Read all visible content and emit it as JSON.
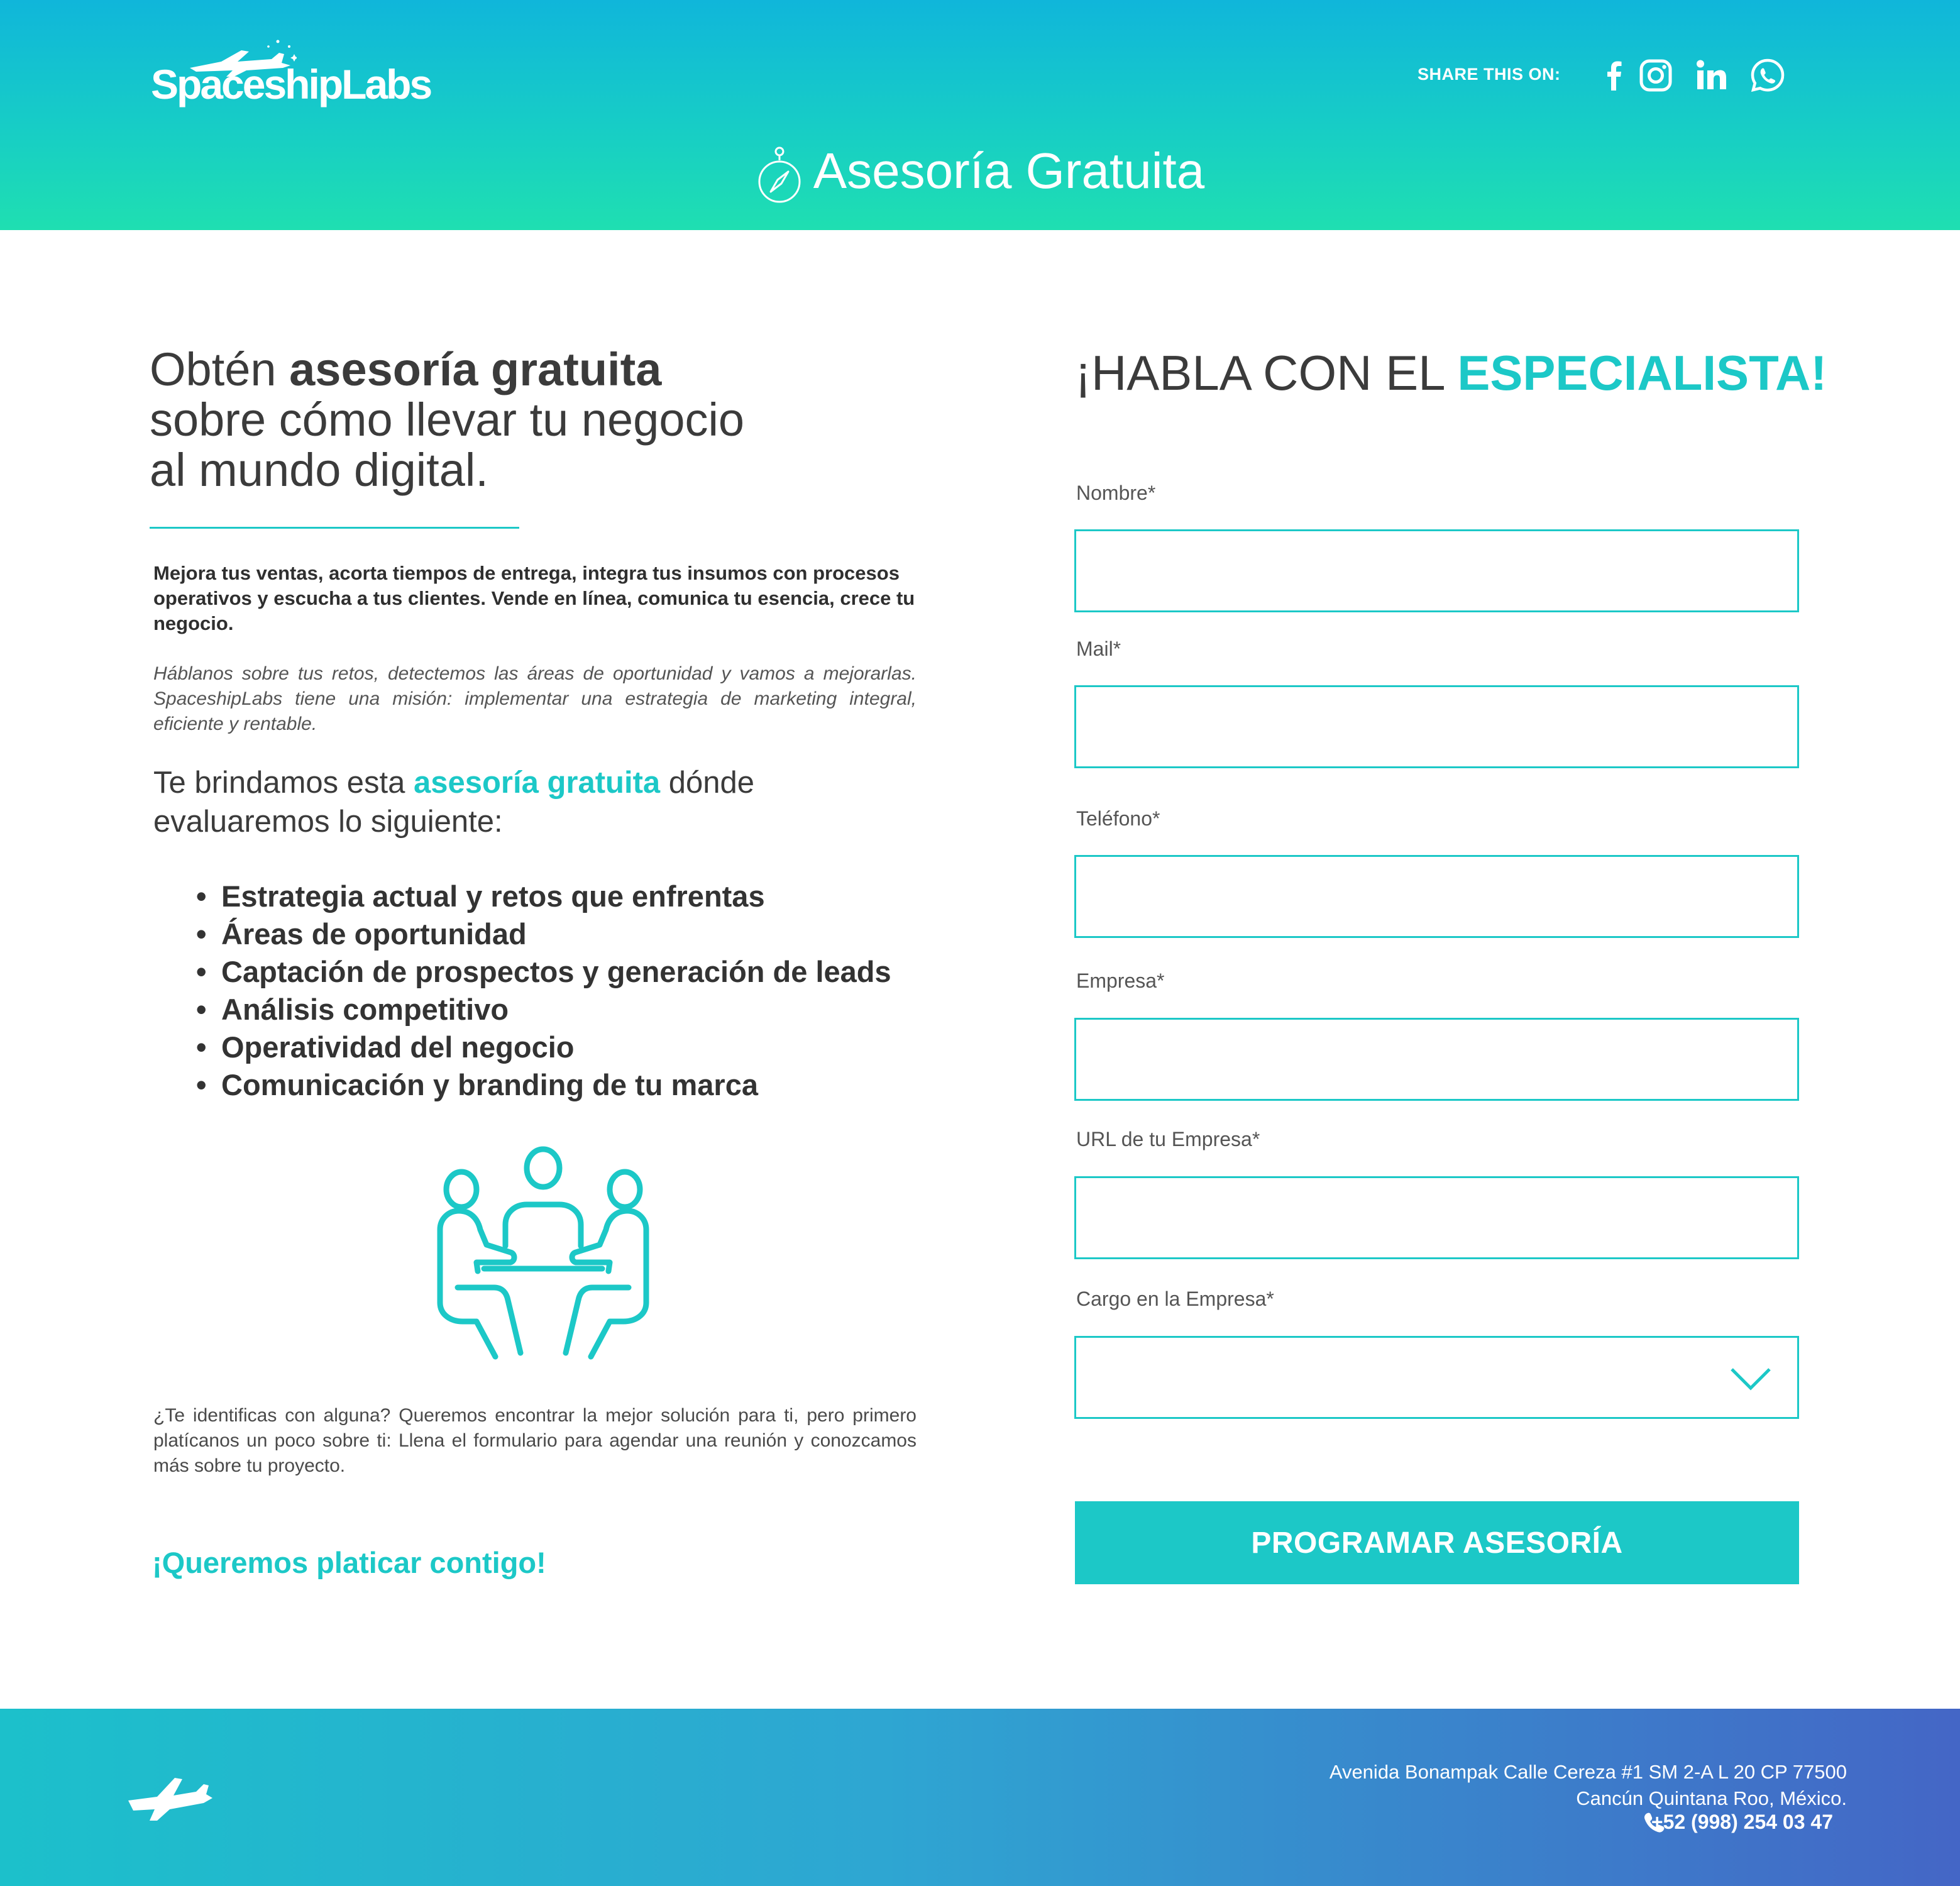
{
  "brand": {
    "logo_text": "SpaceshipLabs",
    "accent_color": "#1cc8c7",
    "header_gradient": [
      "#10b6da",
      "#1fdfb1"
    ],
    "footer_gradient": [
      "#1cc0cb",
      "#4466c6"
    ]
  },
  "header": {
    "share_label": "SHARE THIS ON:",
    "social_icons": [
      "facebook-icon",
      "instagram-icon",
      "linkedin-icon",
      "whatsapp-icon"
    ],
    "hero_icon": "compass-icon",
    "hero_title": "Asesoría Gratuita"
  },
  "left": {
    "heading_pre": "Obtén ",
    "heading_bold": "asesoría gratuita",
    "heading_line2": "sobre cómo llevar tu negocio",
    "heading_line3": "al mundo digital.",
    "intro_bold": "Mejora tus ventas, acorta tiempos de entrega, integra tus insumos con procesos operativos y escucha a tus clientes. Vende en línea, comunica tu esencia, crece tu negocio.",
    "intro_italic": "Háblanos sobre tus retos, detectemos las áreas de oportunidad y vamos a mejorarlas. SpaceshipLabs tiene una misión: implementar una estrategia de marketing integral, eficiente y rentable.",
    "offer_pre": "Te brindamos esta ",
    "offer_highlight": "asesoría gratuita",
    "offer_post": " dónde",
    "offer_line2": "evaluaremos lo siguiente:",
    "bullet": "•",
    "benefits": [
      "Estrategia actual y retos que enfrentas",
      "Áreas de oportunidad",
      "Captación de prospectos y generación de leads",
      "Análisis competitivo",
      "Operatividad del negocio",
      "Comunicación y branding de tu marca"
    ],
    "illustration_icon": "meeting-icon",
    "closing": "¿Te identificas con alguna? Queremos encontrar la mejor solución para ti, pero primero platícanos un poco sobre ti: Llena el formulario para agendar una reunión y conozcamos más sobre tu proyecto.",
    "cta_text": "¡Queremos platicar contigo!"
  },
  "form": {
    "title_pre": "¡HABLA CON EL ",
    "title_highlight": "ESPECIALISTA!",
    "fields": [
      {
        "label": "Nombre*",
        "value": ""
      },
      {
        "label": "Mail*",
        "value": ""
      },
      {
        "label": "Teléfono*",
        "value": ""
      },
      {
        "label": "Empresa*",
        "value": ""
      },
      {
        "label": "URL de tu Empresa*",
        "value": ""
      },
      {
        "label": "Cargo en la Empresa*",
        "value": ""
      }
    ],
    "submit_label": "PROGRAMAR ASESORÍA"
  },
  "footer": {
    "address_line1": "Avenida Bonampak Calle Cereza #1 SM 2-A L 20 CP 77500",
    "address_line2": "Cancún Quintana Roo, México.",
    "phone": "+52 (998) 254 03 47"
  }
}
